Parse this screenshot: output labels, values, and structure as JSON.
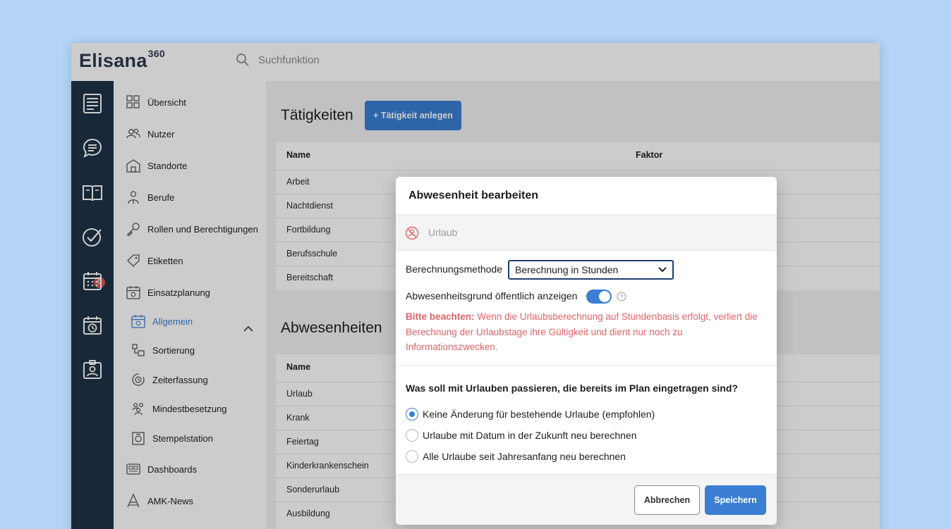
{
  "app": {
    "logo_name": "Elisana",
    "logo_suffix": "360"
  },
  "search": {
    "placeholder": "Suchfunktion"
  },
  "iconbar": {
    "badge_count": "6"
  },
  "subnav": {
    "items": [
      {
        "label": "Übersicht",
        "icon": "grid-icon"
      },
      {
        "label": "Nutzer",
        "icon": "users-icon"
      },
      {
        "label": "Standorte",
        "icon": "building-icon"
      },
      {
        "label": "Berufe",
        "icon": "worker-icon"
      },
      {
        "label": "Rollen und Berechtigungen",
        "icon": "key-icon"
      },
      {
        "label": "Etiketten",
        "icon": "tag-icon"
      },
      {
        "label": "Einsatzplanung",
        "icon": "calendar-icon"
      },
      {
        "label": "Allgemein",
        "icon": "calendar-gear-icon"
      },
      {
        "label": "Sortierung",
        "icon": "sort-icon"
      },
      {
        "label": "Zeiterfassung",
        "icon": "clock-sync-icon"
      },
      {
        "label": "Mindestbesetzung",
        "icon": "staff-icon"
      },
      {
        "label": "Stempelstation",
        "icon": "terminal-icon"
      },
      {
        "label": "Dashboards",
        "icon": "dashboard-icon"
      },
      {
        "label": "AMK-News",
        "icon": "news-icon"
      }
    ]
  },
  "main": {
    "taetigkeiten": {
      "title": "Tätigkeiten",
      "add_button": "+ Tätigkeit anlegen",
      "col_name": "Name",
      "col_factor": "Faktor",
      "rows": [
        "Arbeit",
        "Nachtdienst",
        "Fortbildung",
        "Berufsschule",
        "Bereitschaft"
      ]
    },
    "abwesenheiten": {
      "title": "Abwesenheiten",
      "col_name": "Name",
      "rows": [
        "Urlaub",
        "Krank",
        "Feiertag",
        "Kinderkrankenschein",
        "Sonderurlaub",
        "Ausbildung"
      ]
    }
  },
  "modal": {
    "title": "Abwesenheit bearbeiten",
    "item_name": "Urlaub",
    "method_label": "Berechnungsmethode",
    "method_value": "Berechnung in Stunden",
    "public_label": "Abwesenheitsgrund öffentlich anzeigen",
    "note_prefix": "Bitte beachten:",
    "note_text": " Wenn die Urlaubsberechnung auf Stundenbasis erfolgt, verliert die Berechnung der Urlaubstage ihre Gültigkeit und dient nur noch zu Informationszwecken.",
    "question": "Was soll mit Urlauben passieren, die bereits im Plan eingetragen sind?",
    "options": [
      "Keine Änderung für bestehende Urlaube (empfohlen)",
      "Urlaube mit Datum in der Zukunft neu berechnen",
      "Alle Urlaube seit Jahresanfang neu berechnen"
    ],
    "cancel": "Abbrechen",
    "save": "Speichern"
  },
  "colors": {
    "accent": "#3a7fd3",
    "sidebar": "#1f3347",
    "warning": "#e06366",
    "background": "#b3d4f6"
  }
}
